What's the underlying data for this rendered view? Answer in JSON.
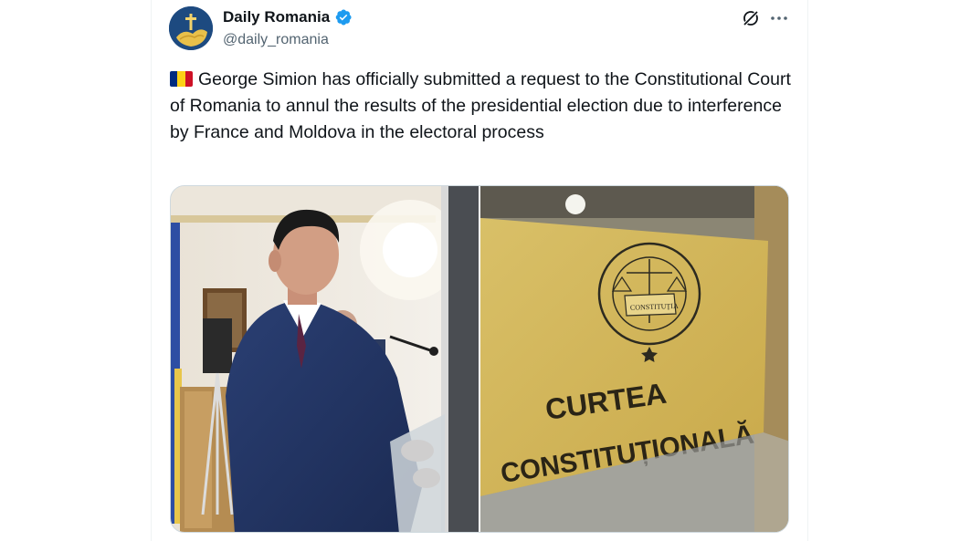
{
  "author": {
    "display_name": "Daily Romania",
    "handle": "@daily_romania",
    "verified": true,
    "avatar_icon": "cross-avatar-icon"
  },
  "tweet": {
    "flag_icon": "romania-flag-icon",
    "text": "George Simion has officially submitted a request to the Constitutional Court of Romania to annul the results of the presidential election due to interference by France and Moldova in the electoral process"
  },
  "media": {
    "sign_line1": "CURTEA",
    "sign_line2": "CONSTITUȚIONALĂ",
    "seal_ring_text": "CURTEA CONSTITUȚIONALĂ A ROMÂNIEI",
    "seal_book_text": "CONSTITUȚIA"
  },
  "colors": {
    "accent": "#1d9bf0",
    "text": "#0f1419",
    "muted": "#536471"
  }
}
